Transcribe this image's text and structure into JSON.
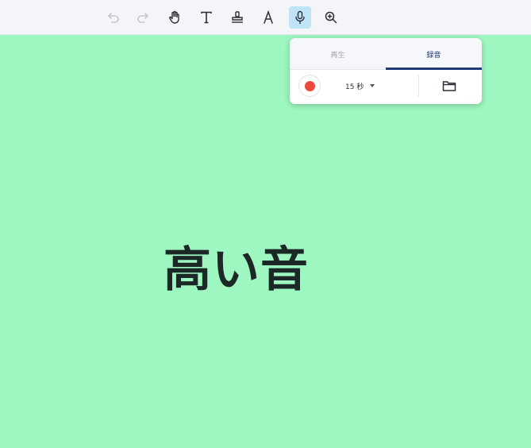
{
  "toolbar": {
    "tools": [
      {
        "name": "undo-button",
        "icon": "undo-icon",
        "enabled": false
      },
      {
        "name": "redo-button",
        "icon": "redo-icon",
        "enabled": false
      },
      {
        "name": "hand-tool-button",
        "icon": "hand-icon"
      },
      {
        "name": "text-tool-button",
        "icon": "text-icon"
      },
      {
        "name": "stamp-tool-button",
        "icon": "stamp-icon"
      },
      {
        "name": "font-tool-button",
        "icon": "font-icon"
      },
      {
        "name": "microphone-tool-button",
        "icon": "microphone-icon",
        "active": true
      },
      {
        "name": "zoom-tool-button",
        "icon": "zoom-in-icon"
      }
    ]
  },
  "canvas": {
    "text": "高い音",
    "background": "#9ef7c0"
  },
  "audio_popup": {
    "tabs": {
      "play": "再生",
      "record": "録音"
    },
    "active_tab": "record",
    "duration": "15 秒",
    "record_color": "#ec4b3c",
    "accent_color": "#1f3a7a"
  }
}
